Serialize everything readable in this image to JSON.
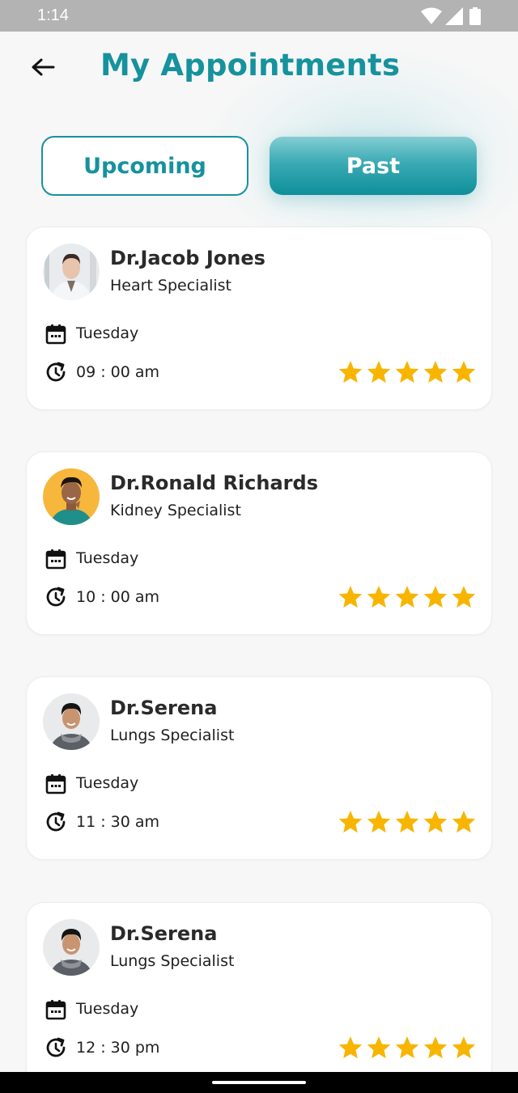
{
  "status_bar": {
    "time": "1:14",
    "icons": [
      "wifi-icon",
      "signal-icon",
      "battery-icon"
    ]
  },
  "header": {
    "title": "My Appointments",
    "back_icon": "arrow-left-icon"
  },
  "tabs": [
    {
      "label": "Upcoming",
      "selected": false
    },
    {
      "label": "Past",
      "selected": true
    }
  ],
  "colors": {
    "accent": "#16929e",
    "star": "#f7b500",
    "background": "#f7f7f7"
  },
  "appointments": [
    {
      "doctor": "Dr.Jacob Jones",
      "specialty": "Heart Specialist",
      "day": "Tuesday",
      "time": "09 : 00 am",
      "rating": 5,
      "rating_max": 5
    },
    {
      "doctor": "Dr.Ronald Richards",
      "specialty": "Kidney Specialist",
      "day": "Tuesday",
      "time": "10 : 00 am",
      "rating": 5,
      "rating_max": 5
    },
    {
      "doctor": "Dr.Serena",
      "specialty": "Lungs Specialist",
      "day": "Tuesday",
      "time": "11 : 30 am",
      "rating": 5,
      "rating_max": 5
    },
    {
      "doctor": "Dr.Serena",
      "specialty": "Lungs Specialist",
      "day": "Tuesday",
      "time": "12 : 30 pm",
      "rating": 5,
      "rating_max": 5
    }
  ]
}
